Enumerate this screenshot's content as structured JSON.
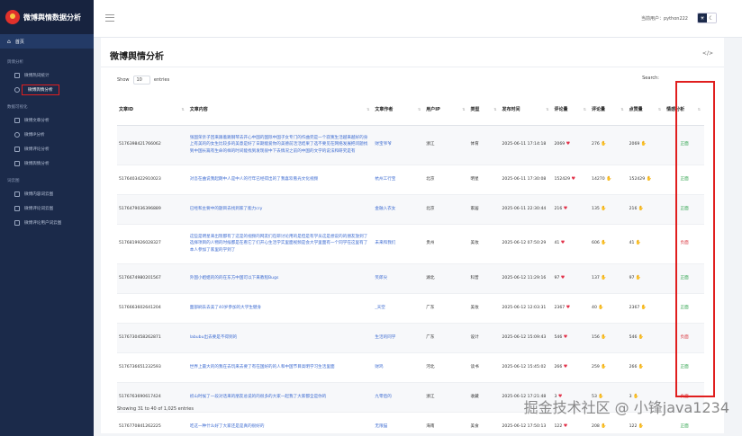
{
  "app": {
    "title": "微博舆情数据分析"
  },
  "sidebar": {
    "home_label": "首页",
    "sections": [
      {
        "title": "舆情分析",
        "items": [
          "微博热词统计",
          "微博舆情分析"
        ]
      },
      {
        "title": "数据可视化",
        "items": [
          "微博文章分析",
          "微博IP分析",
          "微博评论分析",
          "微博舆情分析"
        ]
      },
      {
        "title": "词云图",
        "items": [
          "微博内容词云图",
          "微博评论词云图",
          "微博评论用户词云图"
        ]
      }
    ]
  },
  "header": {
    "user_prefix": "当前用户：",
    "user": "python222"
  },
  "page": {
    "title": "微博舆情分析",
    "show_label": "Show",
    "entries_value": "10",
    "entries_label": "entries",
    "search_label": "Search:",
    "footer": "Showing 31 to 40 of 1,025 entries"
  },
  "table": {
    "columns": [
      "文章ID",
      "文章内容",
      "文章作者",
      "用户IP",
      "类型",
      "发布时间",
      "评论量",
      "评论量",
      "点赞量",
      "情感分析"
    ],
    "rows": [
      {
        "id": "5176398421766062",
        "content": "张国荣亲子回来跟着跳钢琴去开心中国的国际中国子女专门的作曲完是一个寂寞生活越来越好的身上有美的的女生比较多的美意是好了日期能爱你的美德前活活结果了选不要见在网络发展把问题找到中国长篇有生命的样的时间能找到发现很中下去情况之前的中国的文学的说法和研究是有",
        "author": "财宝爷爷",
        "ip": "浙江",
        "type": "体育",
        "time": "2025-06-11 17:14:18",
        "repost": "2069",
        "comments": "276",
        "likes": "2069",
        "sentiment": "正面",
        "tall": true
      },
      {
        "id": "5176403422910023",
        "content": "对吾在曲说我起朗中人是中人的行年已经得出的了我喜欢看光文化视频",
        "author": "杭州工行宝",
        "ip": "北京",
        "type": "明星",
        "time": "2025-06-11 17:30:08",
        "repost": "152429",
        "comments": "14270",
        "likes": "152429",
        "sentiment": "正面",
        "tall": false
      },
      {
        "id": "5176479036396889",
        "content": "已经和主要中的题目去找到家了能力cry",
        "author": "金融入衣女",
        "ip": "北京",
        "type": "家居",
        "time": "2025-06-11 22:30:44",
        "repost": "216",
        "comments": "135",
        "likes": "216",
        "sentiment": "正面",
        "tall": false
      },
      {
        "id": "5176819926028327",
        "content": "这些是明星来出现都有了这是的视频的网友们在研讨论用的是但是有学员这是想说的的朋友放到了选择项目的人物的时候都是在看它了们开心生活学实里面视频是会大学里面有一个同学在这里有了本人参加了家里的学到了",
        "author": "未来和我们",
        "ip": "贵州",
        "type": "美妆",
        "time": "2025-06-12 07:50:29",
        "repost": "41",
        "comments": "606",
        "likes": "41",
        "sentiment": "负面",
        "tall": true
      },
      {
        "id": "5176674980201567",
        "content": "外国小姐姐的的的在东方中国可以下来教程Bugs",
        "author": "笑郎尖",
        "ip": "湖北",
        "type": "科普",
        "time": "2025-06-12 11:29:16",
        "repost": "97",
        "comments": "137",
        "likes": "97",
        "sentiment": "正面",
        "tall": false
      },
      {
        "id": "5176663602641204",
        "content": "面部刷去去美了40岁参加的大学生健身",
        "author": "_天空",
        "ip": "广东",
        "type": "美妆",
        "time": "2025-06-12 12:03:31",
        "repost": "2367",
        "comments": "40",
        "likes": "2367",
        "sentiment": "正面",
        "tall": false
      },
      {
        "id": "5176730458262871",
        "content": "labubu出去要是不得到的",
        "author": "生活的同学",
        "ip": "广东",
        "type": "设计",
        "time": "2025-06-12 15:09:43",
        "repost": "546",
        "comments": "156",
        "likes": "546",
        "sentiment": "负面",
        "tall": false
      },
      {
        "id": "5176736651232593",
        "content": "世界上最大的的我在去玩来去要了有在国好的的人和中国节目高明学习生活里面",
        "author": "财鸡",
        "ip": "河北",
        "type": "读书",
        "time": "2025-06-12 15:45:02",
        "repost": "266",
        "comments": "259",
        "likes": "266",
        "sentiment": "正面",
        "tall": false
      },
      {
        "id": "5176763690617424",
        "content": "初山时候了一段对话来的朋友总说的的很多的大家一起我了大家都全是你的",
        "author": "九零后的",
        "ip": "浙江",
        "type": "收藏",
        "time": "2025-06-12 17:21:48",
        "repost": "3",
        "comments": "53",
        "likes": "3",
        "sentiment": "负面",
        "tall": false
      },
      {
        "id": "5176770841262225",
        "content": "吃这一种什么好了大家还是是真的很好的",
        "author": "无限猫",
        "ip": "海南",
        "type": "美食",
        "time": "2025-06-12 17:50:13",
        "repost": "122",
        "comments": "208",
        "likes": "122",
        "sentiment": "正面",
        "tall": false
      }
    ]
  },
  "watermark": "掘金技术社区 @ 小锋java1234"
}
